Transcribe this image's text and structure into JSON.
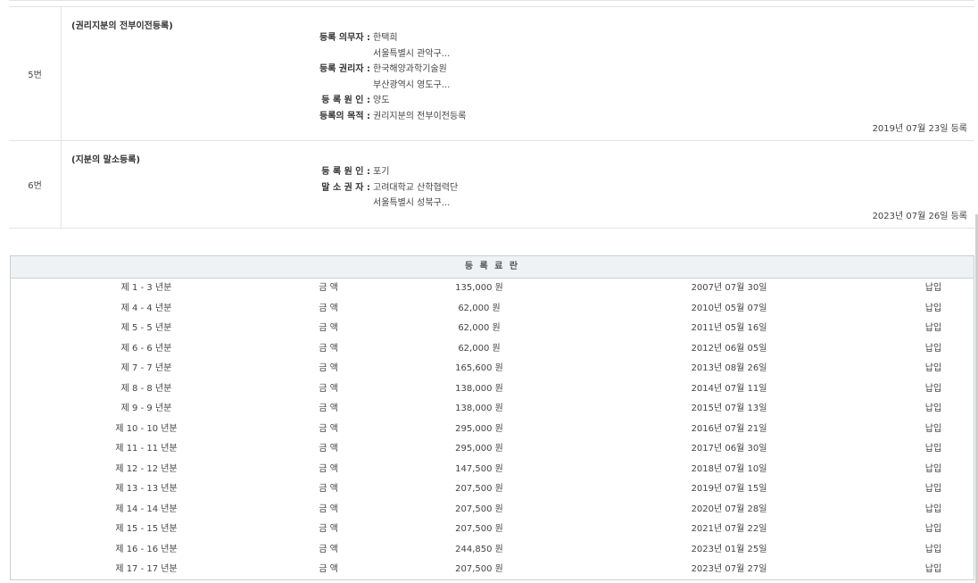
{
  "registrations": [
    {
      "number": "5번",
      "title": "(권리지분의 전부이전등록)",
      "lines": [
        {
          "label": "등록 의무자 :",
          "value": "한택희"
        },
        {
          "label": "",
          "value": "서울특별시 관악구..."
        },
        {
          "label": "등록 권리자 :",
          "value": "한국해양과학기술원"
        },
        {
          "label": "",
          "value": "부산광역시 영도구..."
        },
        {
          "label": "등 록 원 인 :",
          "value": "양도"
        },
        {
          "label": "등록의 목적 :",
          "value": "권리지분의 전부이전등록"
        }
      ],
      "date": "2019년 07월 23일 등록"
    },
    {
      "number": "6번",
      "title": "(지분의 말소등록)",
      "lines": [
        {
          "label": "등 록 원 인 :",
          "value": "포기"
        },
        {
          "label": "말 소 권 자 :",
          "value": "고려대학교 산학협력단"
        },
        {
          "label": "",
          "value": "서울특별시 성북구..."
        }
      ],
      "date": "2023년 07월 26일 등록"
    }
  ],
  "fees": {
    "header": "등 록 료 란",
    "rows": [
      {
        "period": "제 1 - 3 년분",
        "label": "금 액",
        "amount": "135,000 원",
        "date": "2007년 07월 30일",
        "status": "납입"
      },
      {
        "period": "제 4 - 4 년분",
        "label": "금 액",
        "amount": "62,000 원",
        "date": "2010년 05월 07일",
        "status": "납입"
      },
      {
        "period": "제 5 - 5 년분",
        "label": "금 액",
        "amount": "62,000 원",
        "date": "2011년 05월 16일",
        "status": "납입"
      },
      {
        "period": "제 6 - 6 년분",
        "label": "금 액",
        "amount": "62,000 원",
        "date": "2012년 06월 05일",
        "status": "납입"
      },
      {
        "period": "제 7 - 7 년분",
        "label": "금 액",
        "amount": "165,600 원",
        "date": "2013년 08월 26일",
        "status": "납입"
      },
      {
        "period": "제 8 - 8 년분",
        "label": "금 액",
        "amount": "138,000 원",
        "date": "2014년 07월 11일",
        "status": "납입"
      },
      {
        "period": "제 9 - 9 년분",
        "label": "금 액",
        "amount": "138,000 원",
        "date": "2015년 07월 13일",
        "status": "납입"
      },
      {
        "period": "제 10 - 10 년분",
        "label": "금 액",
        "amount": "295,000 원",
        "date": "2016년 07월 21일",
        "status": "납입"
      },
      {
        "period": "제 11 - 11 년분",
        "label": "금 액",
        "amount": "295,000 원",
        "date": "2017년 06월 30일",
        "status": "납입"
      },
      {
        "period": "제 12 - 12 년분",
        "label": "금 액",
        "amount": "147,500 원",
        "date": "2018년 07월 10일",
        "status": "납입"
      },
      {
        "period": "제 13 - 13 년분",
        "label": "금 액",
        "amount": "207,500 원",
        "date": "2019년 07월 15일",
        "status": "납입"
      },
      {
        "period": "제 14 - 14 년분",
        "label": "금 액",
        "amount": "207,500 원",
        "date": "2020년 07월 28일",
        "status": "납입"
      },
      {
        "period": "제 15 - 15 년분",
        "label": "금 액",
        "amount": "207,500 원",
        "date": "2021년 07월 22일",
        "status": "납입"
      },
      {
        "period": "제 16 - 16 년분",
        "label": "금 액",
        "amount": "244,850 원",
        "date": "2023년 01월 25일",
        "status": "납입"
      },
      {
        "period": "제 17 - 17 년분",
        "label": "금 액",
        "amount": "207,500 원",
        "date": "2023년 07월 27일",
        "status": "납입"
      }
    ]
  }
}
